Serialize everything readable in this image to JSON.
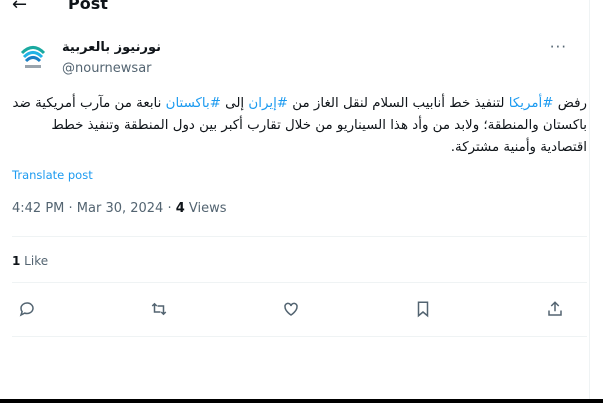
{
  "header": {
    "back_icon": "arrow-left-icon",
    "title": "Post"
  },
  "author": {
    "name": "نورنيوز بالعربية",
    "handle": "@nournewsar"
  },
  "tweet": {
    "text_parts": [
      {
        "text": "رفض ",
        "tag": false
      },
      {
        "text": "#أمريكا",
        "tag": true
      },
      {
        "text": " لتنفيذ خط أنابيب السلام لنقل الغاز من ",
        "tag": false
      },
      {
        "text": "#إيران",
        "tag": true
      },
      {
        "text": " إلى ",
        "tag": false
      },
      {
        "text": "#باكستان",
        "tag": true
      },
      {
        "text": " نابعة من مآرب أمريكية ضد باكستان والمنطقة؛ ولابد من وأد هذا السيناريو من خلال تقارب أكبر بين دول المنطقة وتنفيذ خطط اقتصادية وأمنية مشتركة.",
        "tag": false
      }
    ],
    "translate": "Translate post"
  },
  "meta": {
    "time": "4:42 PM · Mar 30, 2024 · ",
    "views_count": "4",
    "views_label": " Views"
  },
  "likes": {
    "count": "1",
    "label": " Like"
  },
  "actions": [
    "reply-icon",
    "repost-icon",
    "like-icon",
    "bookmark-icon",
    "share-icon"
  ],
  "colors": {
    "link": "#1d9bf0",
    "muted": "#536471",
    "text": "#0f1419"
  }
}
